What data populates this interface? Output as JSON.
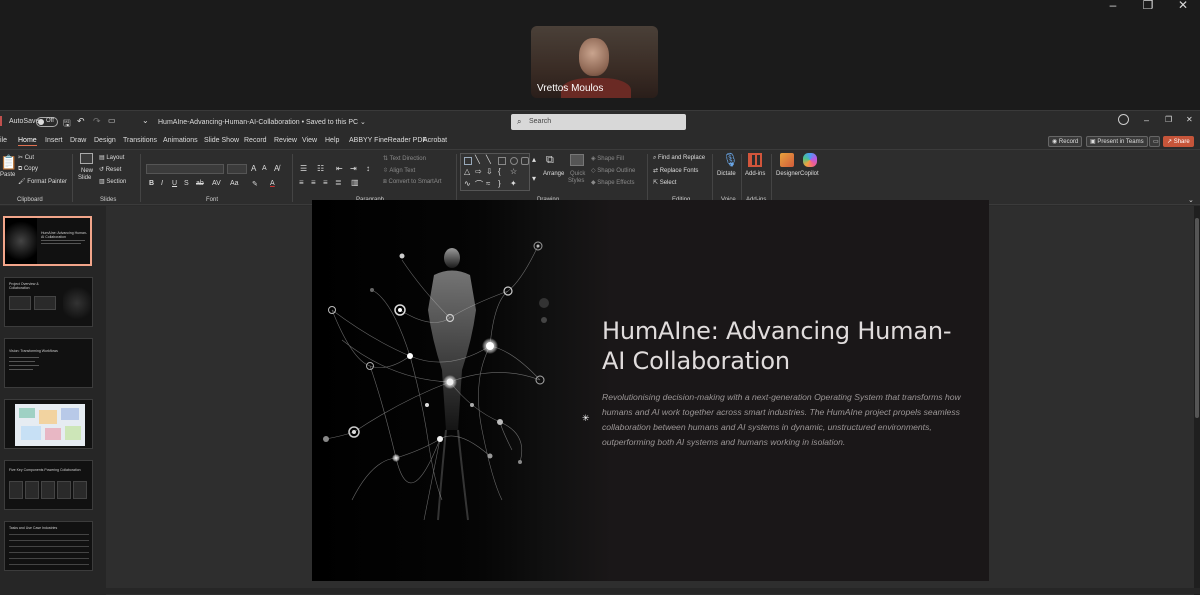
{
  "meeting": {
    "participant_name": "Vrettos Moulos",
    "window_controls": [
      "–",
      "❐",
      "✕"
    ]
  },
  "app": {
    "autosave_label": "AutoSave",
    "autosave_state": "Off",
    "document_title": "HumAIne-Advancing-Human-AI-Collaboration • Saved to this PC ⌄",
    "search_placeholder": "Search",
    "window_controls": [
      "–",
      "❐",
      "✕"
    ]
  },
  "menu": {
    "tabs": [
      "ile",
      "Home",
      "Insert",
      "Draw",
      "Design",
      "Transitions",
      "Animations",
      "Slide Show",
      "Record",
      "Review",
      "View",
      "Help",
      "ABBYY FineReader PDF",
      "Acrobat"
    ],
    "active_tab": "Home",
    "record_button": "Record",
    "present_button": "Present in Teams",
    "share_button": "Share"
  },
  "ribbon": {
    "clipboard": {
      "paste": "Paste",
      "cut": "Cut",
      "copy": "Copy",
      "format_painter": "Format Painter",
      "group": "Clipboard"
    },
    "slides": {
      "new_slide": "New",
      "new_slide2": "Slide",
      "layout": "Layout",
      "reset": "Reset",
      "section": "Section",
      "group": "Slides"
    },
    "font": {
      "group": "Font"
    },
    "paragraph": {
      "text_direction": "Text Direction",
      "align_text": "Align Text",
      "convert_smartart": "Convert to SmartArt",
      "group": "Paragraph"
    },
    "drawing": {
      "arrange": "Arrange",
      "quick_styles": "Quick",
      "quick_styles2": "Styles",
      "shape_fill": "Shape Fill",
      "shape_outline": "Shape Outline",
      "shape_effects": "Shape Effects",
      "group": "Drawing"
    },
    "editing": {
      "find_replace": "Find and Replace",
      "replace_fonts": "Replace Fonts",
      "select": "Select",
      "group": "Editing"
    },
    "voice": {
      "dictate": "Dictate",
      "group": "Voice"
    },
    "addins": {
      "addins": "Add-ins",
      "group": "Add-ins"
    },
    "designer": "Designer",
    "copilot": "Copilot"
  },
  "thumbnails": [
    {
      "num": "1",
      "title": "HumAIne: Advancing Human-AI Collaboration"
    },
    {
      "num": "2",
      "title": "Project Overview & Collaboration"
    },
    {
      "num": "3",
      "title": "Vision: Transforming Workflows"
    },
    {
      "num": "4",
      "title": ""
    },
    {
      "num": "5",
      "title": "Five Key Components Powering Collaboration"
    },
    {
      "num": "6",
      "title": "Tasks and Use Case Industries"
    }
  ],
  "slide": {
    "title": "HumAIne: Advancing Human-AI Collaboration",
    "body": "Revolutionising decision-making with a next-generation Operating System that transforms how humans and AI work together across smart industries. The HumAIne project propels seamless collaboration between humans and AI systems in dynamic, unstructured environments, outperforming both AI systems and humans working in isolation."
  },
  "colors": {
    "accent": "#e07050",
    "selection": "#f2a58a",
    "slide_bg": "#1a1718"
  }
}
